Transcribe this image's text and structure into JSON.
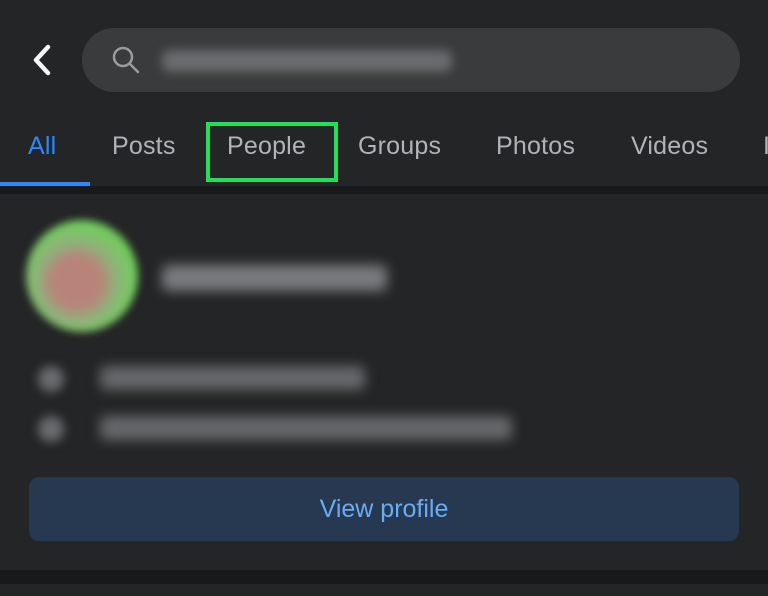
{
  "header": {
    "back_icon": "chevron-left-icon",
    "search_icon": "search-icon"
  },
  "tabs": [
    {
      "label": "All",
      "active": true
    },
    {
      "label": "Posts"
    },
    {
      "label": "People",
      "highlighted": true
    },
    {
      "label": "Groups"
    },
    {
      "label": "Photos"
    },
    {
      "label": "Videos"
    },
    {
      "label": "I"
    }
  ],
  "result": {
    "view_profile_label": "View profile"
  },
  "colors": {
    "accent": "#2d88ff",
    "highlight_box": "#1ee05a",
    "button_bg": "#263951",
    "button_text": "#6aabf5"
  }
}
